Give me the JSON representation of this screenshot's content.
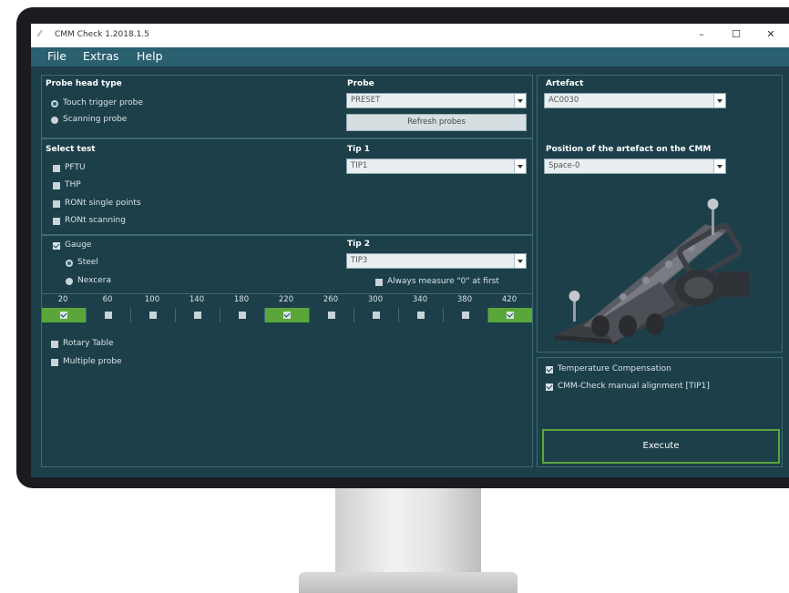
{
  "window": {
    "title": "CMM Check 1.2018.1.5",
    "controls": [
      "–",
      "☐",
      "✕"
    ]
  },
  "menu": [
    "File",
    "Extras",
    "Help"
  ],
  "probe_head": {
    "heading": "Probe head type",
    "options": [
      {
        "label": "Touch trigger probe",
        "selected": true
      },
      {
        "label": "Scanning probe",
        "selected": false
      }
    ]
  },
  "probe": {
    "heading": "Probe",
    "value": "PRESET",
    "refresh_label": "Refresh probes"
  },
  "select_test": {
    "heading": "Select test",
    "items": [
      {
        "label": "PFTU",
        "checked": false
      },
      {
        "label": "THP",
        "checked": false
      },
      {
        "label": "RONt single points",
        "checked": false
      },
      {
        "label": "RONt scanning",
        "checked": false
      }
    ]
  },
  "tip1": {
    "heading": "Tip 1",
    "value": "TIP1"
  },
  "gauge": {
    "label": "Gauge",
    "checked": true,
    "materials": [
      {
        "label": "Steel",
        "selected": true
      },
      {
        "label": "Nexcera",
        "selected": false
      }
    ]
  },
  "tip2": {
    "heading": "Tip 2",
    "value": "TIP3",
    "always_measure_label": "Always measure \"0\" at first"
  },
  "gauge_scale": {
    "values": [
      "20",
      "60",
      "100",
      "140",
      "180",
      "220",
      "260",
      "300",
      "340",
      "380",
      "420"
    ],
    "selected": [
      true,
      false,
      false,
      false,
      false,
      true,
      false,
      false,
      false,
      false,
      true
    ]
  },
  "options": [
    {
      "label": "Rotary Table",
      "checked": false
    },
    {
      "label": "Multiple probe",
      "checked": false
    }
  ],
  "artefact": {
    "heading": "Artefact",
    "value": "AC0030",
    "position_heading": "Position of the artefact on the CMM",
    "position_value": "Space-0"
  },
  "right_options": [
    {
      "label": "Temperature Compensation",
      "checked": true
    },
    {
      "label": "CMM-Check manual alignment   [TIP1]",
      "checked": true
    }
  ],
  "execute_label": "Execute",
  "colors": {
    "background": "#1c3f4a",
    "menubar": "#2a6070",
    "accent_green": "#5aa63a"
  }
}
